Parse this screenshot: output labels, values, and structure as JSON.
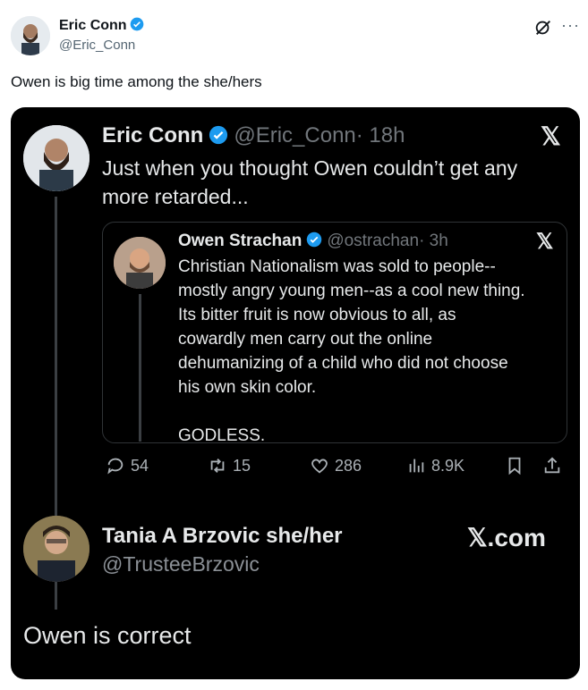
{
  "post": {
    "author_name": "Eric Conn",
    "author_handle": "@Eric_Conn",
    "text": "Owen is big time among the she/hers",
    "more_label": "···"
  },
  "screenshot": {
    "tweet": {
      "author_name": "Eric Conn",
      "author_handle": "@Eric_Conn",
      "time": "· 18h",
      "x_logo": "𝕏",
      "text": "Just when you thought Owen couldn’t get any more retarded..."
    },
    "quoted": {
      "author_name": "Owen Strachan",
      "author_handle": "@ostrachan",
      "time": "· 3h",
      "x_logo": "𝕏",
      "text": "Christian Nationalism was sold to people--\nmostly angry young men--as a cool new thing.\nIts bitter fruit is now obvious to all, as\ncowardly men carry out the online\ndehumanizing of a child who did not choose\nhis own skin color.\n\nGODLESS."
    },
    "actions": {
      "replies": "54",
      "reposts": "15",
      "likes": "286",
      "views": "8.9K"
    },
    "reply": {
      "author_name": "Tania A Brzovic she/her",
      "author_handle": "@TrusteeBrzovic",
      "site": "𝕏.com",
      "text": "Owen is correct"
    }
  },
  "colors": {
    "verified": "#1d9bf0",
    "background": "#000000",
    "muted": "#71767b"
  }
}
